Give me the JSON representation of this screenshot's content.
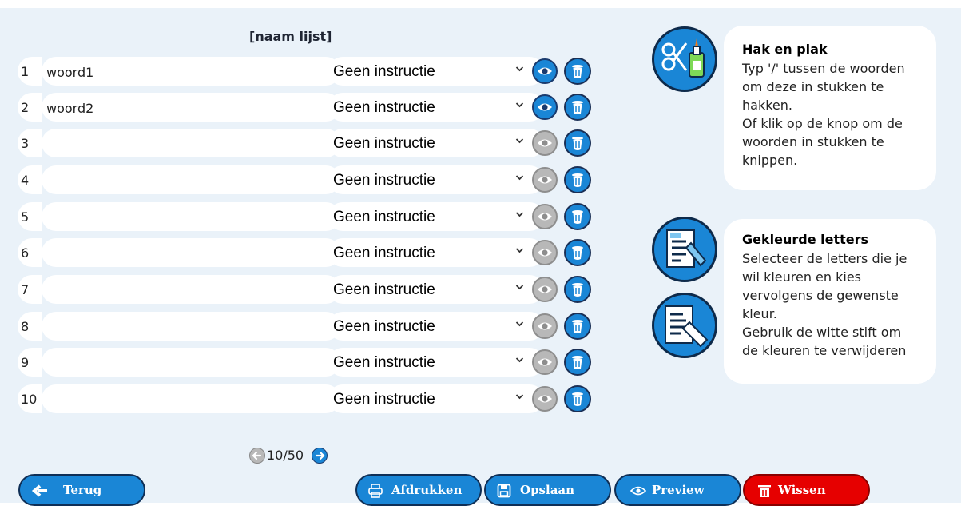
{
  "list_title": "[naam lijst]",
  "rows": [
    {
      "num": "1",
      "word": "woord1",
      "instruction": "Geen instructie",
      "preview_active": true
    },
    {
      "num": "2",
      "word": "woord2",
      "instruction": "Geen instructie",
      "preview_active": true
    },
    {
      "num": "3",
      "word": "",
      "instruction": "Geen instructie",
      "preview_active": false
    },
    {
      "num": "4",
      "word": "",
      "instruction": "Geen instructie",
      "preview_active": false
    },
    {
      "num": "5",
      "word": "",
      "instruction": "Geen instructie",
      "preview_active": false
    },
    {
      "num": "6",
      "word": "",
      "instruction": "Geen instructie",
      "preview_active": false
    },
    {
      "num": "7",
      "word": "",
      "instruction": "Geen instructie",
      "preview_active": false
    },
    {
      "num": "8",
      "word": "",
      "instruction": "Geen instructie",
      "preview_active": false
    },
    {
      "num": "9",
      "word": "",
      "instruction": "Geen instructie",
      "preview_active": false
    },
    {
      "num": "10",
      "word": "",
      "instruction": "Geen instructie",
      "preview_active": false
    }
  ],
  "pager": {
    "text": "10/50"
  },
  "info": {
    "hak": {
      "heading": "Hak en plak",
      "text": "Typ '/' tussen de woorden\nom deze in stukken te\nhakken.\nOf klik op de knop om de\nwoorden in stukken te\nknippen.",
      "icon": "scissors-glue-icon"
    },
    "gekleurd": {
      "heading": "Gekleurde letters",
      "text": "Selecteer de letters die je\nwil kleuren en kies\nvervolgens de gewenste\nkleur.\nGebruik de witte stift om\nde kleuren te verwijderen",
      "icons": [
        "color-marker-icon",
        "white-marker-icon"
      ]
    }
  },
  "buttons": {
    "back": "Terug",
    "print": "Afdrukken",
    "save": "Opslaan",
    "preview": "Preview",
    "clear": "Wissen"
  },
  "colors": {
    "background": "#eaf2f9",
    "accent_blue": "#1a86d6",
    "danger_red": "#e60000",
    "inactive_gray": "#b8b8b8"
  }
}
